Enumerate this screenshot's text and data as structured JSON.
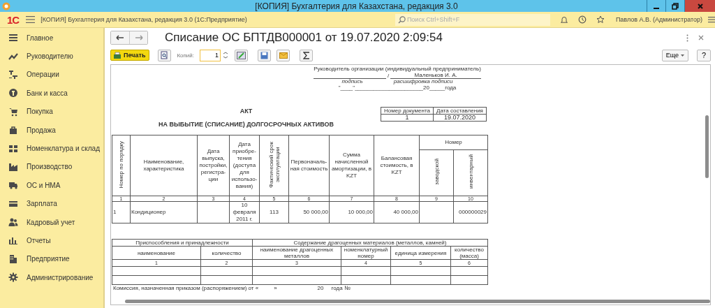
{
  "window": {
    "title": "[КОПИЯ] Бухгалтерия для Казахстана, редакция 3.0"
  },
  "app": {
    "logo": "1С",
    "title": "[КОПИЯ] Бухгалтерия для Казахстана, редакция 3.0  (1С:Предприятие)",
    "search": {
      "placeholder": "Поиск Ctrl+Shift+F"
    },
    "user": "Павлов А.В. (Администратор)"
  },
  "sidebar": {
    "items": [
      {
        "label": "Главное"
      },
      {
        "label": "Руководителю"
      },
      {
        "label": "Операции"
      },
      {
        "label": "Банк и касса"
      },
      {
        "label": "Покупка"
      },
      {
        "label": "Продажа"
      },
      {
        "label": "Номенклатура и склад"
      },
      {
        "label": "Производство"
      },
      {
        "label": "ОС и НМА"
      },
      {
        "label": "Зарплата"
      },
      {
        "label": "Кадровый учет"
      },
      {
        "label": "Отчеты"
      },
      {
        "label": "Предприятие"
      },
      {
        "label": "Администрирование"
      }
    ]
  },
  "document": {
    "title": "Списание ОС БПТДВ000001 от 19.07.2020 2:09:54",
    "toolbar": {
      "print": "Печать",
      "copies_label": "Копий:",
      "copies": {
        "value": "1"
      },
      "more": "Еще",
      "help": "?"
    },
    "signature": {
      "role": "Руководитель организации (индивидуальный предприниматель)",
      "name": "Маленьков И. А.",
      "separator": "/",
      "sign_caption": "подпись",
      "decode_caption": "расшифровка подписи",
      "date_line": "\"____\"______________________20_____года"
    },
    "act": {
      "title": "АКТ",
      "subtitle": "НА ВЫБЫТИЕ (СПИСАНИЕ) ДОЛГОСРОЧНЫХ АКТИВОВ"
    },
    "doc_number": {
      "headers": [
        "Номер документа",
        "Дата составления"
      ],
      "values": [
        "1",
        "19.07.2020"
      ]
    },
    "assets_table": {
      "columns": [
        {
          "label": "Номер по порядку",
          "vertical": true
        },
        {
          "label": "Наименование, характеристика",
          "vertical": false
        },
        {
          "label": "Дата выпуска, постройки, регистра-ции",
          "vertical": false
        },
        {
          "label": "Дата приобре-тения (доступа для использо-вания)",
          "vertical": false
        },
        {
          "label": "Фактический срок эксплуатации",
          "vertical": true
        },
        {
          "label": "Первоначаль-ная стоимость",
          "vertical": false
        },
        {
          "label": "Сумма начисленной амортизации, в KZT",
          "vertical": false
        },
        {
          "label": "Балансовая стоимость, в KZT",
          "vertical": false
        }
      ],
      "group": {
        "label": "Номер",
        "columns": [
          {
            "label": "заводской",
            "vertical": true
          },
          {
            "label": "инвентарный",
            "vertical": true
          }
        ]
      },
      "numbers": [
        "1",
        "2",
        "3",
        "4",
        "5",
        "6",
        "7",
        "8",
        "9",
        "10"
      ],
      "rows": [
        [
          "1",
          "Кондиционер",
          "",
          "10 февраля 2011 г.",
          "113",
          "50 000,00",
          "10 000,00",
          "40 000,00",
          "",
          "000000029"
        ]
      ]
    },
    "accessories_table": {
      "group_left": "Приспособления и принадлежности",
      "group_right": "Содержание драгоценных материалов (металлов, камней)",
      "columns": [
        "наименование",
        "количество",
        "наименование драгоценных металлов",
        "номенклатурный номер",
        "единица измерения",
        "количество (масса)"
      ],
      "numbers": [
        "1",
        "2",
        "3",
        "4",
        "5",
        "6"
      ]
    },
    "commission": "Комиссия, назначенная приказом (распоряжением) от «          »                          20     года №"
  }
}
